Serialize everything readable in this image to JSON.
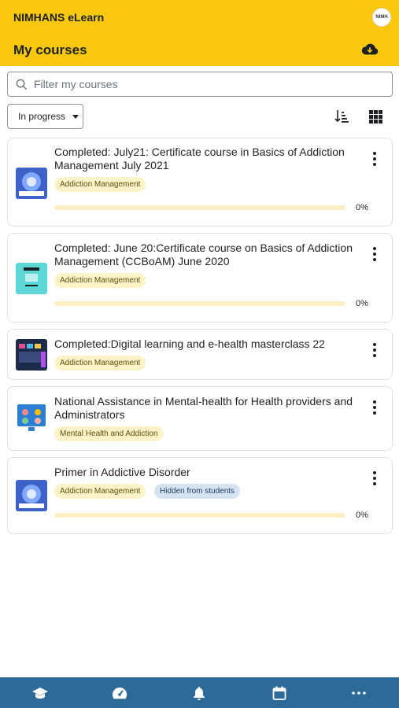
{
  "header": {
    "site_name": "NIMHANS eLearn",
    "page_title": "My courses",
    "logo_text": "NIMH",
    "logo_icon": "site-logo",
    "download_icon": "cloud-download-icon"
  },
  "search": {
    "placeholder": "Filter my courses",
    "value": ""
  },
  "filter": {
    "selected": "In progress"
  },
  "toolbar": {
    "sort_icon": "sort-descending-icon",
    "view_icon": "grid-view-icon"
  },
  "courses": [
    {
      "title": "Completed: July21: Certificate course in Basics of Addiction Management July 2021",
      "category": "Addiction Management",
      "progress": "0%",
      "progress_fraction": 0,
      "thumb_color": "#3f62c8"
    },
    {
      "title": "Completed: June 20:Certificate course on Basics of Addiction Management (CCBoAM) June 2020",
      "category": "Addiction Management",
      "progress": "0%",
      "progress_fraction": 0,
      "thumb_color": "#5cd6d6"
    },
    {
      "title": "Completed:Digital learning and e-health masterclass 22",
      "category": "Addiction Management",
      "thumb_color": "#1e2a4a"
    },
    {
      "title": "National Assistance in Mental-health for Health providers and Administrators",
      "category": "Mental Health and Addiction",
      "thumb_color": "#2a7fd4"
    },
    {
      "title": "Primer in Addictive Disorder",
      "category": "Addiction Management",
      "hidden_label": "Hidden from students",
      "progress": "0%",
      "progress_fraction": 0,
      "thumb_color": "#3f62c8"
    }
  ],
  "tabbar": {
    "items": [
      "graduation-cap-icon",
      "dashboard-gauge-icon",
      "bell-icon",
      "calendar-icon",
      "more-icon"
    ]
  },
  "colors": {
    "brand_yellow": "#f9c80e",
    "tabbar_blue": "#2d6a97",
    "tag_yellow": "#fdf3c8",
    "tag_blue": "#d6e4f2"
  }
}
